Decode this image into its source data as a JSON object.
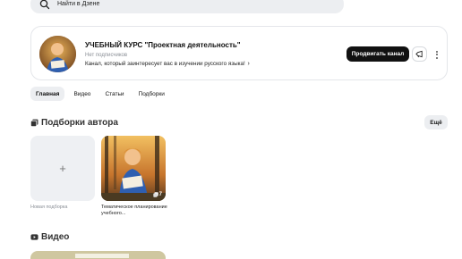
{
  "search": {
    "placeholder": "Найти в Дзене"
  },
  "channel": {
    "title": "УЧЕБНЫЙ КУРС \"Проектная деятельность\"",
    "subscribers": "Нет подписчиков",
    "description": "Канал, который заинтересует вас в изучении русского языка!",
    "description_chevron": "›",
    "promote_label": "Продвигать канал"
  },
  "tabs": [
    {
      "label": "Главная",
      "active": true
    },
    {
      "label": "Видео",
      "active": false
    },
    {
      "label": "Статьи",
      "active": false
    },
    {
      "label": "Подборки",
      "active": false
    }
  ],
  "collections": {
    "title": "Подборки автора",
    "more_label": "Ещё",
    "new_tile": {
      "plus": "+",
      "label": "Новая подборка"
    },
    "items": [
      {
        "label": "Тематическое планирование учебного...",
        "count": "7"
      }
    ]
  },
  "video_section": {
    "title": "Видео"
  },
  "colors": {
    "accent_dark": "#111111",
    "panel_gray": "#eceef1"
  },
  "icons": [
    "search-icon",
    "megaphone-icon",
    "more-vertical-icon",
    "collections-icon",
    "video-icon"
  ]
}
